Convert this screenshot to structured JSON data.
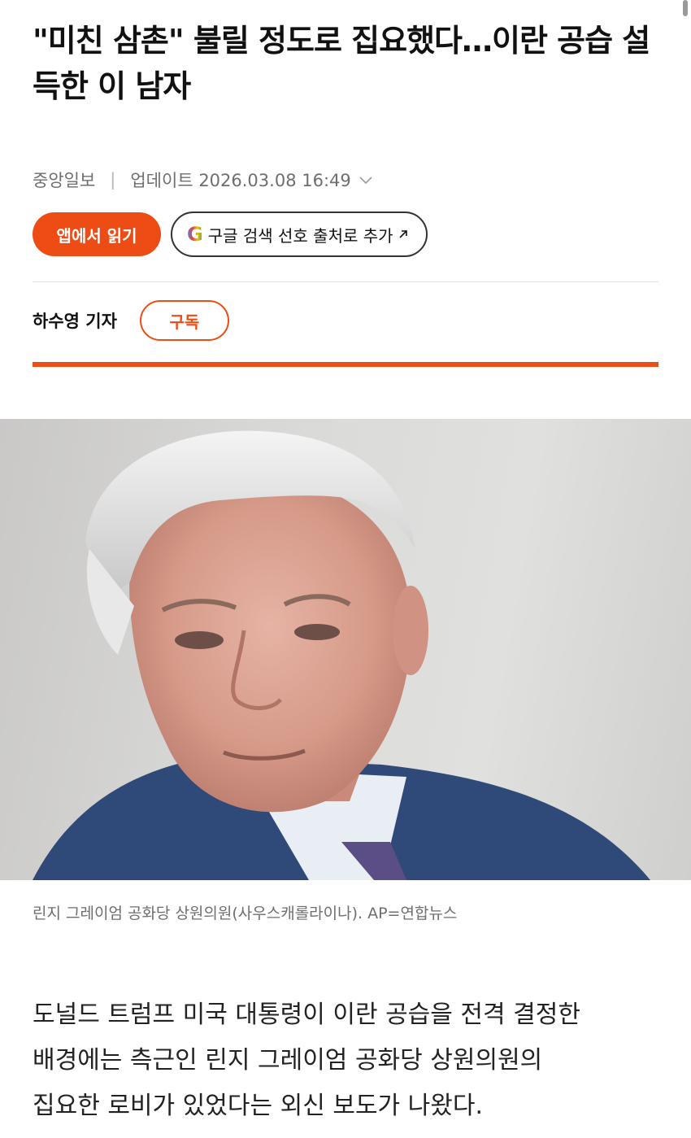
{
  "article": {
    "headline": "\"미친 삼촌\" 불릴 정도로 집요했다…이란 공습 설득한 이 남자",
    "source": "중앙일보",
    "updated": "업데이트 2026.03.08 16:49"
  },
  "actions": {
    "app_button": "앱에서 읽기",
    "google_g": "G",
    "google_button": "구글 검색 선호 출처로 추가"
  },
  "author": {
    "name": "하수영 기자",
    "subscribe": "구독"
  },
  "photo": {
    "caption": "린지 그레이엄 공화당 상원의원(사우스캐롤라이나). AP=연합뉴스"
  },
  "body": {
    "lines": [
      "도널드 트럼프 미국 대통령이 이란 공습을 전격 결정한",
      "배경에는 측근인 린지 그레이엄 공화당 상원의원의",
      "집요한 로비가 있었다는 외신 보도가 나왔다."
    ]
  },
  "colors": {
    "accent": "#ed4d14",
    "meta_text": "#6e6e6e"
  }
}
